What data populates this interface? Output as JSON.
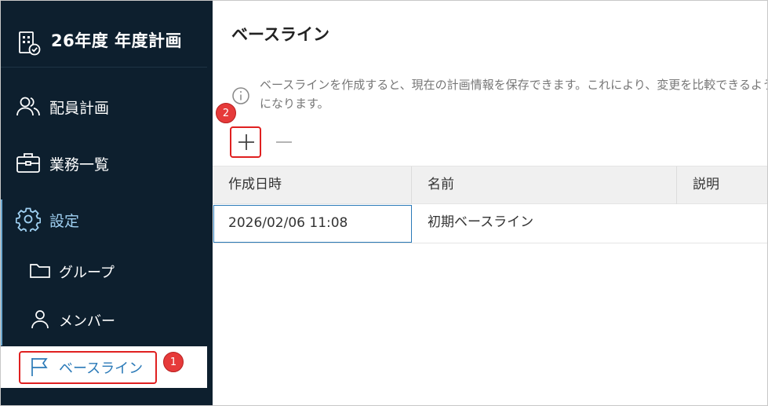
{
  "app": {
    "title": "26年度 年度計画",
    "logo_icon": "building-check-icon"
  },
  "sidebar": {
    "items": [
      {
        "label": "配員計画",
        "icon": "people-icon"
      },
      {
        "label": "業務一覧",
        "icon": "briefcase-icon"
      },
      {
        "label": "設定",
        "icon": "gear-icon"
      }
    ],
    "sub_items": [
      {
        "label": "グループ",
        "icon": "folder-icon"
      },
      {
        "label": "メンバー",
        "icon": "person-icon"
      },
      {
        "label": "ベースライン",
        "icon": "flag-icon"
      }
    ]
  },
  "main": {
    "title": "ベースライン",
    "info_text": "ベースラインを作成すると、現在の計画情報を保存できます。これにより、変更を比較できるようになります。",
    "toolbar": {
      "add_icon": "plus-icon",
      "remove_icon": "minus-icon"
    },
    "table": {
      "columns": [
        "作成日時",
        "名前",
        "説明"
      ],
      "rows": [
        {
          "created": "2026/02/06 11:08",
          "name": "初期ベースライン",
          "description": ""
        }
      ]
    }
  },
  "annotations": {
    "badge1": "1",
    "badge2": "2"
  },
  "colors": {
    "sidebar_bg": "#0d1f2e",
    "accent": "#2b7ab8",
    "annotation": "#e02020"
  }
}
